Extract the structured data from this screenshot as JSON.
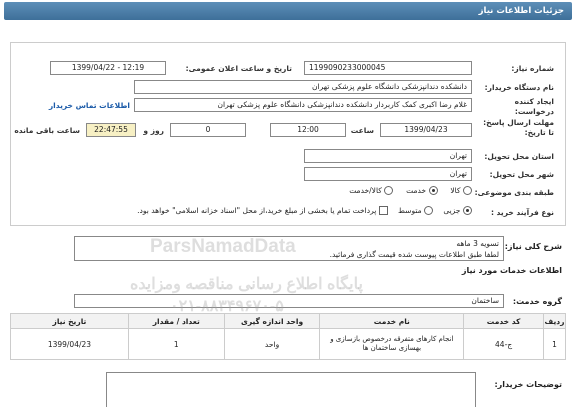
{
  "header": {
    "title": "جزئیات اطلاعات نیاز"
  },
  "need_number": {
    "label": "شماره نیاز:",
    "value": "1199090233000045"
  },
  "announce_datetime": {
    "label": "تاریخ و ساعت اعلان عمومی:",
    "value": "1399/04/22 - 12:19"
  },
  "buyer_org": {
    "label": "نام دستگاه خریدار:",
    "value": "دانشکده دندانپزشکی  دانشگاه علوم پزشکی تهران"
  },
  "creator": {
    "label": "ایجاد کننده درخواست:",
    "value": "غلام رضا   اکبری کمک  کاربردار دانشکده دندانپزشکی دانشگاه علوم پزشکی تهران",
    "contact_link": "اطلاعات تماس خریدار"
  },
  "reply_deadline": {
    "label": "مهلت ارسال پاسخ: تا تاریخ:",
    "date": "1399/04/23",
    "time_label": "ساعت",
    "time": "12:00",
    "days": "0",
    "days_label": "روز و",
    "remaining": "22:47:55",
    "remaining_label": "ساعت باقی مانده"
  },
  "delivery_province": {
    "label": "استان محل تحویل:",
    "value": "تهران"
  },
  "delivery_city": {
    "label": "شهر محل تحویل:",
    "value": "تهران"
  },
  "subject_class": {
    "label": "طبقه بندی موضوعی:",
    "options": [
      "کالا",
      "خدمت",
      "کالا/خدمت"
    ],
    "selected": "خدمت"
  },
  "purchase_type": {
    "label": "نوع فرآیند خرید :",
    "options": [
      "جزیی",
      "متوسط"
    ],
    "selected": "جزیی",
    "note": "پرداخت تمام یا بخشی از مبلغ خرید،از محل \"اسناد خزانه اسلامی\" خواهد بود."
  },
  "need_summary": {
    "label": "شرح کلی نیاز:",
    "line1": "تسویه 3 ماهه",
    "line2": "لطفا طبق اطلاعات پیوست شده قیمت گذاری فرمائید."
  },
  "services_section": {
    "title": "اطلاعات خدمات مورد نیاز"
  },
  "service_group": {
    "label": "گروه خدمت:",
    "value": "ساختمان"
  },
  "table": {
    "headers": [
      "ردیف",
      "کد خدمت",
      "نام خدمت",
      "واحد اندازه گیری",
      "تعداد / مقدار",
      "تاریخ نیاز"
    ],
    "rows": [
      [
        "1",
        "ج-44",
        "انجام کارهای متفرقه درخصوص بازسازی و بهسازی ساختمان ها",
        "واحد",
        "1",
        "1399/04/23"
      ]
    ]
  },
  "buyer_notes": {
    "label": "توضیحات خریدار:"
  },
  "watermark": {
    "line1": "ParsNamadData",
    "line2": "پایگاه اطلاع رسانی مناقصه ومزایده",
    "line3": "۰۲۱-۸۸۳۴۹۶۷۰-۵"
  }
}
